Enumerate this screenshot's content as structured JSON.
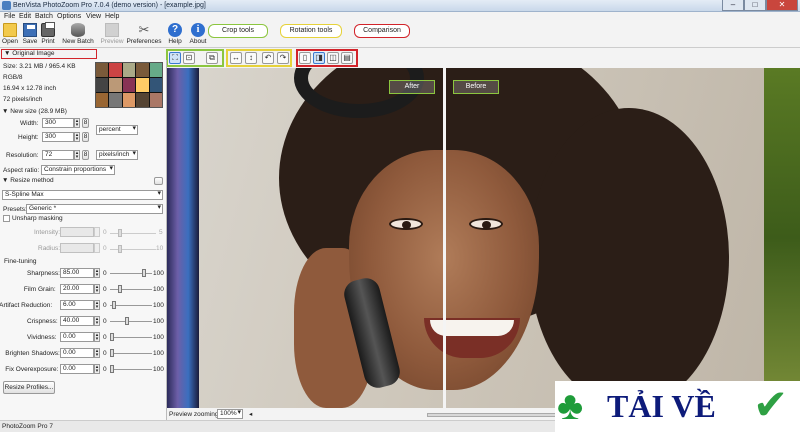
{
  "window": {
    "title": "BenVista PhotoZoom Pro 7.0.4 (demo version) - [example.jpg]",
    "min": "–",
    "max": "□",
    "close": "✕"
  },
  "menu": [
    "File",
    "Edit",
    "Batch",
    "Options",
    "View",
    "Help"
  ],
  "toolbar": {
    "open": "Open",
    "save": "Save",
    "print": "Print",
    "new_batch": "New Batch",
    "preview": "Preview",
    "preferences": "Preferences",
    "help": "Help",
    "about": "About",
    "help_glyph": "?",
    "about_glyph": "i",
    "prefs_glyph": "✂"
  },
  "callouts": {
    "crop": "Crop tools",
    "rotation": "Rotation tools",
    "comparison": "Comparison"
  },
  "tools": {
    "t1": "⛶",
    "t2": "⊡",
    "crop": "⧉",
    "flip_h": "↔",
    "flip_v": "↕",
    "rot_l": "↶",
    "rot_r": "↷",
    "c1": "▯",
    "c2": "◨",
    "c3": "◫",
    "c4": "▤"
  },
  "left": {
    "original_image": "▼ Original Image",
    "size": "Size: 3.21 MB / 965.4 KB",
    "mode": "RGB/8",
    "dimensions": "16.94 x 12.78 inch",
    "resolution_info": "72 pixels/inch",
    "new_size": "▼ New size (28.9 MB)",
    "width_label": "Width:",
    "width_value": "300",
    "height_label": "Height:",
    "height_value": "300",
    "unit": "percent",
    "resolution_label": "Resolution:",
    "resolution_value": "72",
    "res_unit": "pixels/inch",
    "aspect_label": "Aspect ratio:",
    "aspect_value": "Constrain proportions",
    "resize_method": "▼ Resize method",
    "method_value": "S-Spline Max",
    "presets_label": "Presets:",
    "presets_value": "Generic *",
    "unsharp": "Unsharp masking",
    "intensity_label": "Intensity:",
    "radius_label": "Radius:",
    "intensity_min": "0",
    "intensity_max": "5",
    "radius_min": "0",
    "radius_max": "10",
    "finetuning": "Fine-tuning",
    "rows": [
      {
        "label": "Sharpness:",
        "value": "85.00",
        "min": "0",
        "max": "100",
        "level": 0.85
      },
      {
        "label": "Film Grain:",
        "value": "20.00",
        "min": "0",
        "max": "100",
        "level": 0.2
      },
      {
        "label": "Artifact Reduction:",
        "value": "6.00",
        "min": "0",
        "max": "100",
        "level": 0.06
      },
      {
        "label": "Crispness:",
        "value": "40.00",
        "min": "0",
        "max": "100",
        "level": 0.4
      },
      {
        "label": "Vividness:",
        "value": "0.00",
        "min": "0",
        "max": "100",
        "level": 0.0
      },
      {
        "label": "Brighten Shadows:",
        "value": "0.00",
        "min": "0",
        "max": "100",
        "level": 0.0
      },
      {
        "label": "Fix Overexposure:",
        "value": "0.00",
        "min": "0",
        "max": "100",
        "level": 0.0
      }
    ],
    "resize_profiles": "Resize Profiles..."
  },
  "view": {
    "after": "After",
    "before": "Before"
  },
  "bottom": {
    "zoom_label": "Preview zooming:",
    "zoom_value": "100%"
  },
  "status": {
    "text": "PhotoZoom Pro 7"
  },
  "watermark": {
    "text": "TẢI VỀ",
    "clover": "♣",
    "check": "✔"
  },
  "colors": {
    "crop_box": "#8cc63f",
    "rotation_box": "#e6d23a",
    "comparison_box": "#d2232a",
    "label_border": "#8cc63f"
  }
}
